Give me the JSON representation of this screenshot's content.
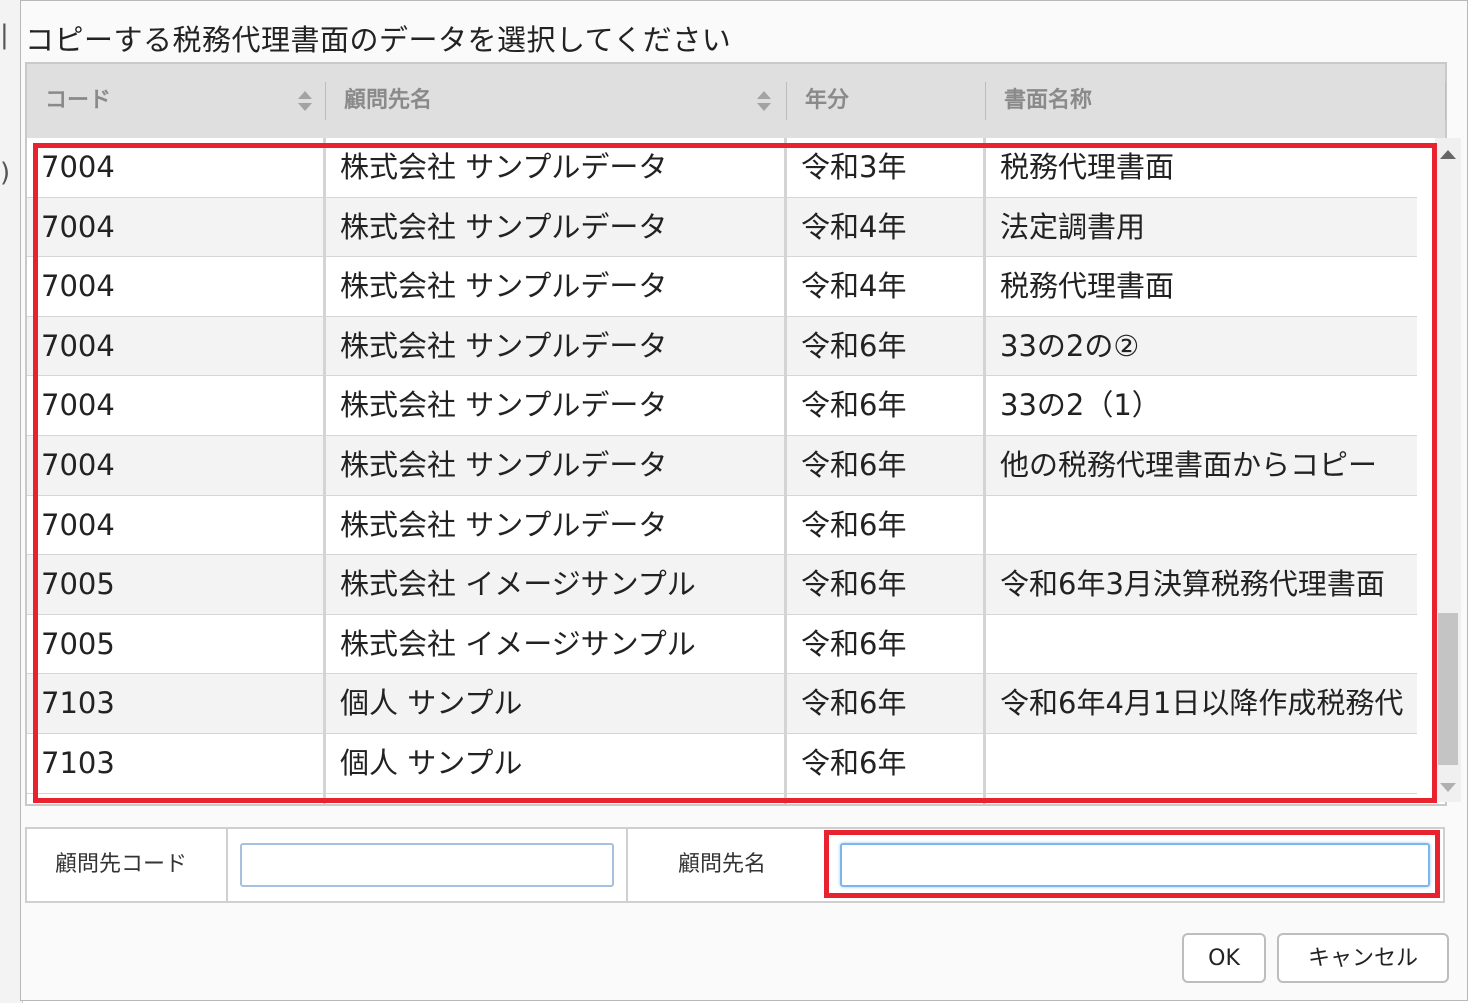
{
  "dialog": {
    "title": "コピーする税務代理書面のデータを選択してください"
  },
  "grid": {
    "columns": [
      {
        "label": "コード",
        "sortable": true
      },
      {
        "label": "顧問先名",
        "sortable": true
      },
      {
        "label": "年分",
        "sortable": false
      },
      {
        "label": "書面名称",
        "sortable": false
      }
    ],
    "rows": [
      {
        "code": "7004",
        "client": "株式会社 サンプルデータ",
        "year": "令和3年",
        "doc": "税務代理書面"
      },
      {
        "code": "7004",
        "client": "株式会社 サンプルデータ",
        "year": "令和4年",
        "doc": "法定調書用"
      },
      {
        "code": "7004",
        "client": "株式会社 サンプルデータ",
        "year": "令和4年",
        "doc": "税務代理書面"
      },
      {
        "code": "7004",
        "client": "株式会社 サンプルデータ",
        "year": "令和6年",
        "doc": "33の2の②"
      },
      {
        "code": "7004",
        "client": "株式会社 サンプルデータ",
        "year": "令和6年",
        "doc": "33の2（1）"
      },
      {
        "code": "7004",
        "client": "株式会社 サンプルデータ",
        "year": "令和6年",
        "doc": "他の税務代理書面からコピー"
      },
      {
        "code": "7004",
        "client": "株式会社 サンプルデータ",
        "year": "令和6年",
        "doc": ""
      },
      {
        "code": "7005",
        "client": "株式会社 イメージサンプル",
        "year": "令和6年",
        "doc": "令和6年3月決算税務代理書面"
      },
      {
        "code": "7005",
        "client": "株式会社 イメージサンプル",
        "year": "令和6年",
        "doc": ""
      },
      {
        "code": "7103",
        "client": "個人 サンプル",
        "year": "令和6年",
        "doc": "令和6年4月1日以降作成税務代"
      },
      {
        "code": "7103",
        "client": "個人 サンプル",
        "year": "令和6年",
        "doc": ""
      }
    ]
  },
  "search": {
    "code_label": "顧問先コード",
    "code_value": "",
    "name_label": "顧問先名",
    "name_value": ""
  },
  "buttons": {
    "ok": "OK",
    "cancel": "キャンセル"
  },
  "colors": {
    "highlight": "#e8222e",
    "header_bg": "#dfdfdf",
    "alt_row": "#f3f3f3"
  }
}
